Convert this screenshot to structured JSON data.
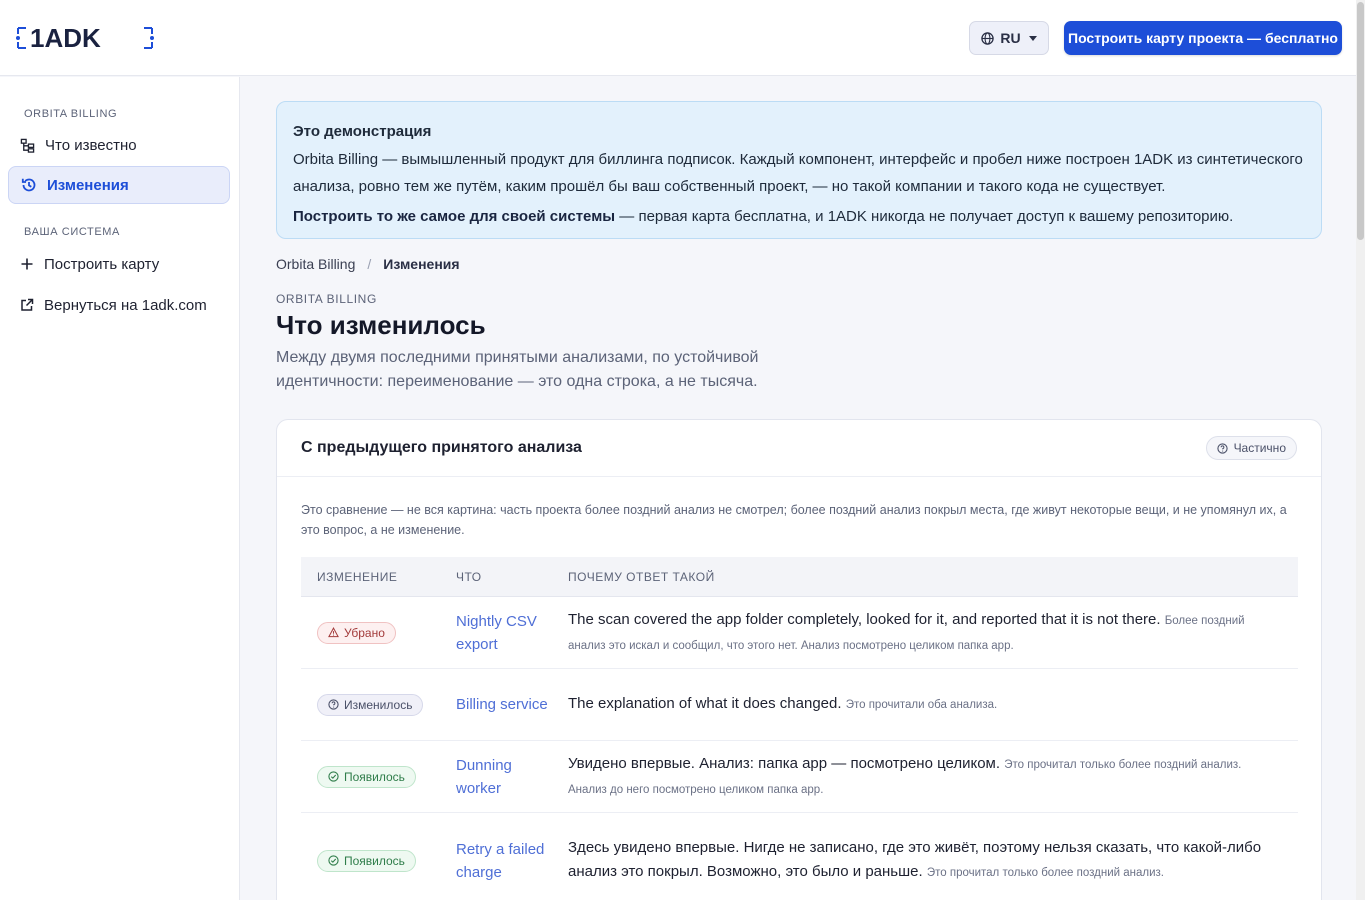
{
  "header": {
    "logo_text": "1ADK",
    "lang_label": "RU",
    "cta_label": "Построить карту проекта — бесплатно"
  },
  "sidebar": {
    "section1": "ORBITA BILLING",
    "section2": "ВАША СИСТЕМА",
    "items": [
      {
        "label": "Что известно",
        "icon": "tree-icon"
      },
      {
        "label": "Изменения",
        "icon": "history-icon",
        "active": true
      },
      {
        "label": "Построить карту",
        "icon": "plus-icon"
      },
      {
        "label": "Вернуться на 1adk.com",
        "icon": "external-link-icon"
      }
    ]
  },
  "banner": {
    "title": "Это демонстрация",
    "body": "Orbita Billing — вымышленный продукт для биллинга подписок. Каждый компонент, интерфейс и пробел ниже построен 1ADK из синтетического анализа, ровно тем же путём, каким прошёл бы ваш собственный проект, — но такой компании и такого кода не существует.",
    "link_text": "Построить то же самое для своей системы",
    "link_tail": " — первая карта бесплатна, и 1ADK никогда не получает доступ к вашему репозиторию."
  },
  "breadcrumb": {
    "root": "Orbita Billing",
    "separator": "/",
    "current": "Изменения"
  },
  "page": {
    "eyebrow": "ORBITA BILLING",
    "title": "Что изменилось",
    "subtitle": "Между двумя последними принятыми анализами, по устойчивой идентичности: переименование — это одна строка, а не тысяча."
  },
  "card": {
    "title": "С предыдущего принятого анализа",
    "status": "Частично",
    "note": "Это сравнение — не вся картина: часть проекта более поздний анализ не смотрел; более поздний анализ покрыл места, где живут некоторые вещи, и не упомянул их, а это вопрос, а не изменение.",
    "columns": [
      "ИЗМЕНЕНИЕ",
      "ЧТО",
      "ПОЧЕМУ ОТВЕТ ТАКОЙ"
    ],
    "rows": [
      {
        "badge": "Убрано",
        "kind": "removed",
        "what": "Nightly CSV export",
        "why": "The scan covered the app folder completely, looked for it, and reported that it is not there.",
        "why_note": "Более поздний анализ это искал и сообщил, что этого нет. Анализ посмотрено целиком папка app."
      },
      {
        "badge": "Изменилось",
        "kind": "changed",
        "what": "Billing service",
        "why": "The explanation of what it does changed.",
        "why_note": "Это прочитали оба анализа."
      },
      {
        "badge": "Появилось",
        "kind": "appeared",
        "what": "Dunning worker",
        "why": "Увидено впервые. Анализ: папка app — посмотрено целиком.",
        "why_note": "Это прочитал только более поздний анализ. Анализ до него посмотрено целиком папка app."
      },
      {
        "badge": "Появилось",
        "kind": "appeared",
        "what": "Retry a failed charge",
        "why": "Здесь увидено впервые. Нигде не записано, где это живёт, поэтому нельзя сказать, что какой-либо анализ это покрыл. Возможно, это было и раньше.",
        "why_note": "Это прочитал только более поздний анализ."
      }
    ]
  },
  "colors": {
    "primary": "#1d4ed8",
    "banner_bg": "#e3f1fc",
    "link": "#4f6fd6"
  }
}
